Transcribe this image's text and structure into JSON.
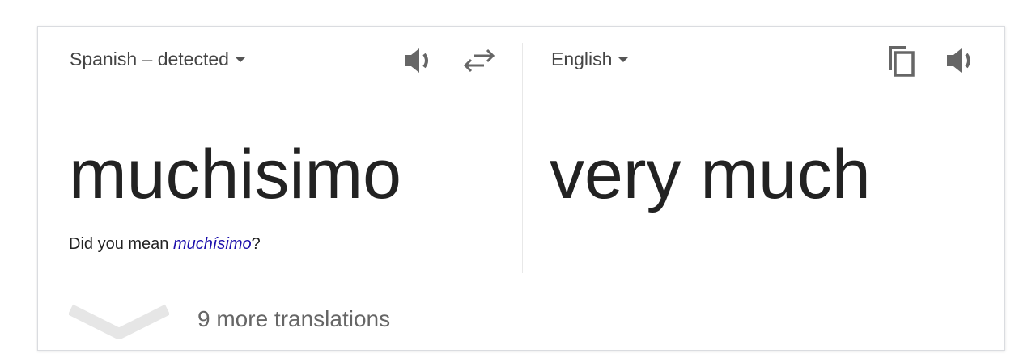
{
  "source": {
    "language_label": "Spanish – detected",
    "text": "muchisimo",
    "suggestion_prefix": "Did you mean ",
    "suggestion_word": "muchísimo",
    "suggestion_suffix": "?",
    "icons": [
      "speaker-icon",
      "swap-icon"
    ]
  },
  "target": {
    "language_label": "English",
    "text": "very much",
    "icons": [
      "copy-icon",
      "speaker-icon"
    ]
  },
  "footer": {
    "more_label": "9 more translations",
    "icon": "chevron-down-icon"
  },
  "colors": {
    "text": "#222222",
    "label": "#444444",
    "icon": "#666666",
    "link": "#1a0dab",
    "divider": "#e8e8e8"
  }
}
